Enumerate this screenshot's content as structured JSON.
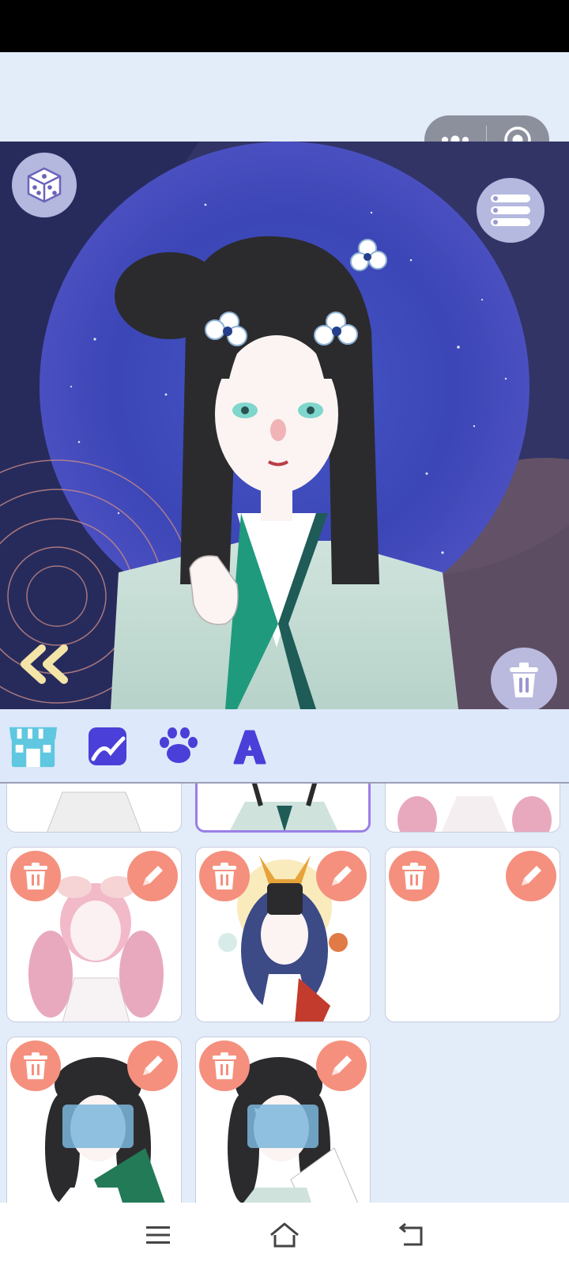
{
  "app": {
    "capsule": {
      "more_icon": "more-dots-icon",
      "close_icon": "target-circle-icon"
    }
  },
  "canvas": {
    "random_button_icon": "dice-icon",
    "menu_button_icon": "list-icon",
    "collapse_button_icon": "double-chevron-left-icon",
    "delete_button_icon": "trash-icon",
    "character_colors": {
      "hair": "#2b2b2e",
      "robe": "#cfe3dc",
      "accent": "#1f9a7d",
      "skin": "#fbf4f2"
    }
  },
  "toolbar": {
    "tabs": [
      {
        "icon": "shop-icon"
      },
      {
        "icon": "background-image-icon"
      },
      {
        "icon": "paw-icon"
      },
      {
        "icon": "letter-a-icon"
      }
    ]
  },
  "saved_looks": {
    "delete_icon": "trash-icon",
    "edit_icon": "pencil-icon",
    "accent_color": "#f5907e",
    "selected_color": "#9a7fe6"
  },
  "nav": {
    "menu_icon": "menu-icon",
    "home_icon": "home-icon",
    "back_icon": "back-icon"
  }
}
